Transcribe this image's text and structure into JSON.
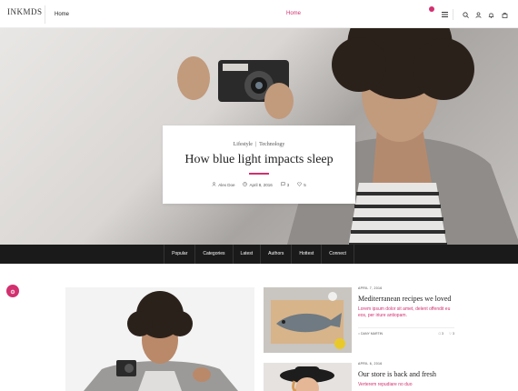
{
  "header": {
    "logo_text": "INKMDS",
    "nav_home": "Home",
    "center_label": "Home",
    "icons": [
      "menu-icon",
      "search-icon",
      "user-icon",
      "bell-icon",
      "bag-icon"
    ]
  },
  "hero": {
    "categories": [
      "Lifestyle",
      "Technology"
    ],
    "title": "How blue light impacts sleep",
    "author": "Alex Doe",
    "date": "April 8, 2016",
    "comments": "3",
    "likes": "5"
  },
  "catbar": {
    "items": [
      "Popular",
      "Categories",
      "Latest",
      "Authors",
      "Hottest",
      "Connect"
    ]
  },
  "posts": [
    {
      "date": "APRIL 7, 2016",
      "title": "Mediterranean recipes we loved",
      "excerpt": "Lorem ipsum dolor sit amet, delent offendit eu eos, per iriure antiopam.",
      "author": "DANY MARTIN",
      "comments": "3",
      "likes": "3"
    },
    {
      "date": "APRIL 6, 2016",
      "title": "Our store is back and fresh",
      "excerpt": "Verterem repudiare no duo"
    }
  ],
  "colors": {
    "accent": "#d2306f",
    "dark_bar": "#1a1a1a"
  }
}
